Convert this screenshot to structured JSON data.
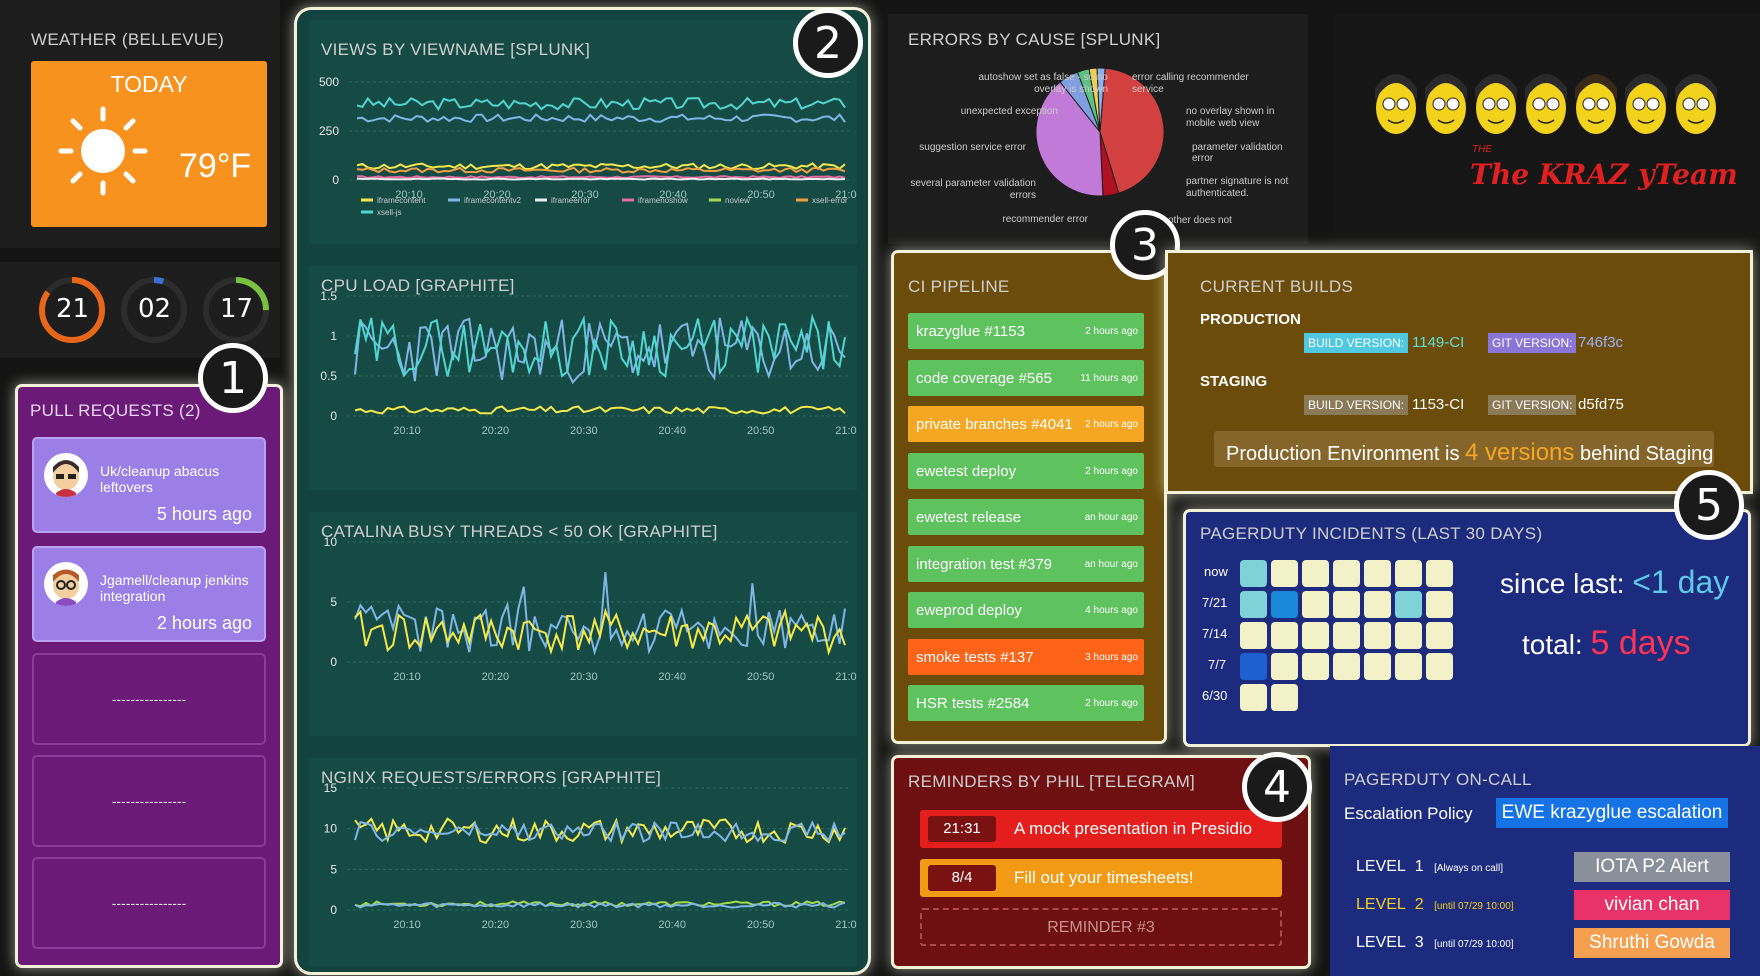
{
  "weather": {
    "title": "WEATHER (BELLEVUE)",
    "day": "TODAY",
    "temp": "79°F",
    "icon": "sun-icon"
  },
  "counters": [
    {
      "value": "21",
      "ring_color": "#e8661a",
      "fraction": 0.85
    },
    {
      "value": "02",
      "ring_color": "#3b6fd8",
      "fraction": 0.05
    },
    {
      "value": "17",
      "ring_color": "#7ac142",
      "fraction": 0.25
    }
  ],
  "pull_requests": {
    "title": "PULL REQUESTS (2)",
    "items": [
      {
        "title": "Uk/cleanup abacus leftovers",
        "age": "5 hours ago"
      },
      {
        "title": "Jgamell/cleanup jenkins integration",
        "age": "2 hours ago"
      }
    ],
    "empty_label": "----------------"
  },
  "charts": [
    {
      "title": "VIEWS BY VIEWNAME [SPLUNK]",
      "yticks": [
        "500",
        "250",
        "0"
      ],
      "xticks": [
        "20:10",
        "20:20",
        "20:30",
        "20:40",
        "20:50",
        "21:00"
      ],
      "legend": [
        {
          "name": "iframecontent",
          "color": "#f5e94a"
        },
        {
          "name": "iframecontentv2",
          "color": "#7fb6e6"
        },
        {
          "name": "iframeerror",
          "color": "#eeeeee"
        },
        {
          "name": "iframenoshow",
          "color": "#e86aa0"
        },
        {
          "name": "noview",
          "color": "#a3d94a"
        },
        {
          "name": "xsell-error",
          "color": "#f0a040"
        },
        {
          "name": "xsell-js",
          "color": "#4fd6d0"
        }
      ]
    },
    {
      "title": "CPU LOAD [GRAPHITE]",
      "yticks": [
        "1.5",
        "1",
        "0.5",
        "0"
      ],
      "xticks": [
        "20:10",
        "20:20",
        "20:30",
        "20:40",
        "20:50",
        "21:00"
      ]
    },
    {
      "title": "CATALINA BUSY THREADS  < 50 OK [GRAPHITE]",
      "yticks": [
        "10",
        "5",
        "0"
      ],
      "xticks": [
        "20:10",
        "20:20",
        "20:30",
        "20:40",
        "20:50",
        "21:00"
      ]
    },
    {
      "title": "NGINX REQUESTS/ERRORS [GRAPHITE]",
      "yticks": [
        "15",
        "10",
        "5",
        "0"
      ],
      "xticks": [
        "20:10",
        "20:20",
        "20:30",
        "20:40",
        "20:50",
        "21:00"
      ]
    }
  ],
  "errors": {
    "title": "ERRORS BY CAUSE [SPLUNK]",
    "labels": [
      "autoshow set as false - so no overlay is shown",
      "unexpected exception",
      "suggestion service error",
      "several parameter validation errors",
      "recommender error",
      "error calling recommender service",
      "no overlay shown in mobile web view",
      "parameter validation error",
      "partner signature is not authenticated.",
      "other does not"
    ],
    "slices": [
      {
        "value": 44,
        "color": "#d24040"
      },
      {
        "value": 4,
        "color": "#b01020"
      },
      {
        "value": 40,
        "color": "#c27ad8"
      },
      {
        "value": 5,
        "color": "#7e9fe0"
      },
      {
        "value": 3,
        "color": "#5cc080"
      },
      {
        "value": 2,
        "color": "#f0d050"
      },
      {
        "value": 2,
        "color": "#8ab0f0"
      }
    ]
  },
  "team": {
    "name": "The KRAZ yTeam",
    "subtitle": "THE"
  },
  "ci": {
    "title": "CI PIPELINE",
    "items": [
      {
        "name": "krazyglue #1153",
        "when": "2 hours ago",
        "color": "#5ec25e"
      },
      {
        "name": "code coverage #565",
        "when": "11 hours ago",
        "color": "#5ec25e"
      },
      {
        "name": "private branches #4041",
        "when": "2 hours ago",
        "color": "#f5a623"
      },
      {
        "name": "ewetest deploy",
        "when": "2 hours ago",
        "color": "#5ec25e"
      },
      {
        "name": "ewetest release",
        "when": "an hour ago",
        "color": "#5ec25e"
      },
      {
        "name": "integration test #379",
        "when": "an hour ago",
        "color": "#5ec25e"
      },
      {
        "name": "eweprod deploy",
        "when": "4 hours ago",
        "color": "#5ec25e"
      },
      {
        "name": "smoke tests #137",
        "when": "3 hours ago",
        "color": "#ff6318"
      },
      {
        "name": "HSR tests #2584",
        "when": "2 hours ago",
        "color": "#5ec25e"
      }
    ]
  },
  "builds": {
    "title": "CURRENT BUILDS",
    "production": {
      "label": "PRODUCTION",
      "build_tag": "BUILD VERSION:",
      "build": "1149-CI",
      "git_tag": "GIT VERSION:",
      "git": "746f3c"
    },
    "staging": {
      "label": "STAGING",
      "build_tag": "BUILD VERSION:",
      "build": "1153-CI",
      "git_tag": "GIT VERSION:",
      "git": "d5fd75"
    },
    "summary_pre": "Production Environment is",
    "summary_num": "4 versions",
    "summary_post": "behind Staging"
  },
  "reminders": {
    "title": "REMINDERS BY PHIL [TELEGRAM]",
    "items": [
      {
        "time": "21:31",
        "text": "A mock presentation in Presidio"
      },
      {
        "time": "8/4",
        "text": "Fill out your timesheets!"
      }
    ],
    "placeholder": "REMINDER #3"
  },
  "pd_incidents": {
    "title": "PAGERDUTY INCIDENTS (LAST 30 DAYS)",
    "rows": [
      "now",
      "7/21",
      "7/14",
      "7/7",
      "6/30"
    ],
    "since_label": "since last:",
    "since_value": "<1 day",
    "total_label": "total:",
    "total_value": "5 days"
  },
  "pd_oncall": {
    "title": "PAGERDUTY ON-CALL",
    "policy_label": "Escalation Policy",
    "policy": "EWE krazyglue escalation",
    "levels": [
      {
        "label": "LEVEL",
        "num": "1",
        "note": "[Always on call]",
        "who": "IOTA P2 Alert",
        "color": "#8a8f9c"
      },
      {
        "label": "LEVEL",
        "num": "2",
        "note": "[until 07/29 10:00]",
        "who": "vivian chan",
        "color": "#e8336a"
      },
      {
        "label": "LEVEL",
        "num": "3",
        "note": "[until 07/29 10:00]",
        "who": "Shruthi Gowda",
        "color": "#f5a050"
      }
    ]
  },
  "callouts": [
    "1",
    "2",
    "3",
    "4",
    "5"
  ]
}
